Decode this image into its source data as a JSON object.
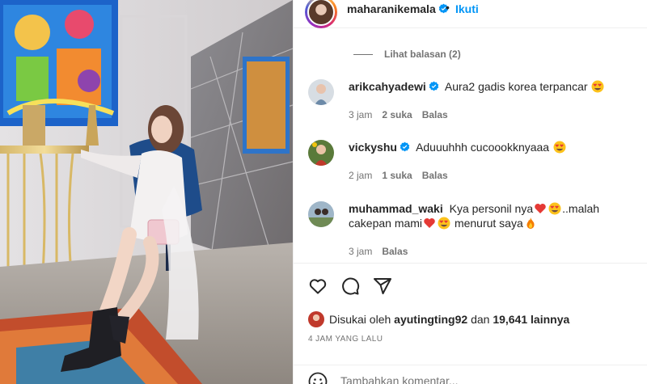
{
  "post": {
    "author": "maharanikemala",
    "follow_label": "Ikuti",
    "separator": "•"
  },
  "view_replies": "Lihat balasan (2)",
  "comments": [
    {
      "user": "arikcahyadewi",
      "verified": true,
      "text": "Aura2 gadis korea terpancar",
      "emoji": [
        "heart-eyes"
      ],
      "time": "3 jam",
      "likes": "2 suka",
      "reply": "Balas"
    },
    {
      "user": "vickyshu",
      "verified": true,
      "text": "Aduuuhhh cucoookknyaaa",
      "emoji": [
        "heart-eyes"
      ],
      "time": "2 jam",
      "likes": "1 suka",
      "reply": "Balas"
    },
    {
      "user": "muhammad_waki",
      "verified": false,
      "text_parts": [
        "Kya personil nya",
        "..malah cakepan mami",
        "menurut saya"
      ],
      "emoji": [
        "red-heart",
        "heart-eyes",
        "red-heart",
        "heart-eyes",
        "fire"
      ],
      "time": "3 jam",
      "likes": "",
      "reply": "Balas"
    }
  ],
  "actions": {
    "icons": [
      "heart-icon",
      "comment-icon",
      "share-icon"
    ]
  },
  "likes": {
    "prefix": "Disukai oleh",
    "user": "ayutingting92",
    "middle": "dan",
    "count": "19,641 lainnya"
  },
  "timeago": "4 JAM YANG LALU",
  "add_comment": {
    "placeholder": "Tambahkan komentar..."
  },
  "colors": {
    "accent": "#0095f6",
    "text": "#262626",
    "muted": "#737373",
    "like_red": "#ed4956"
  }
}
